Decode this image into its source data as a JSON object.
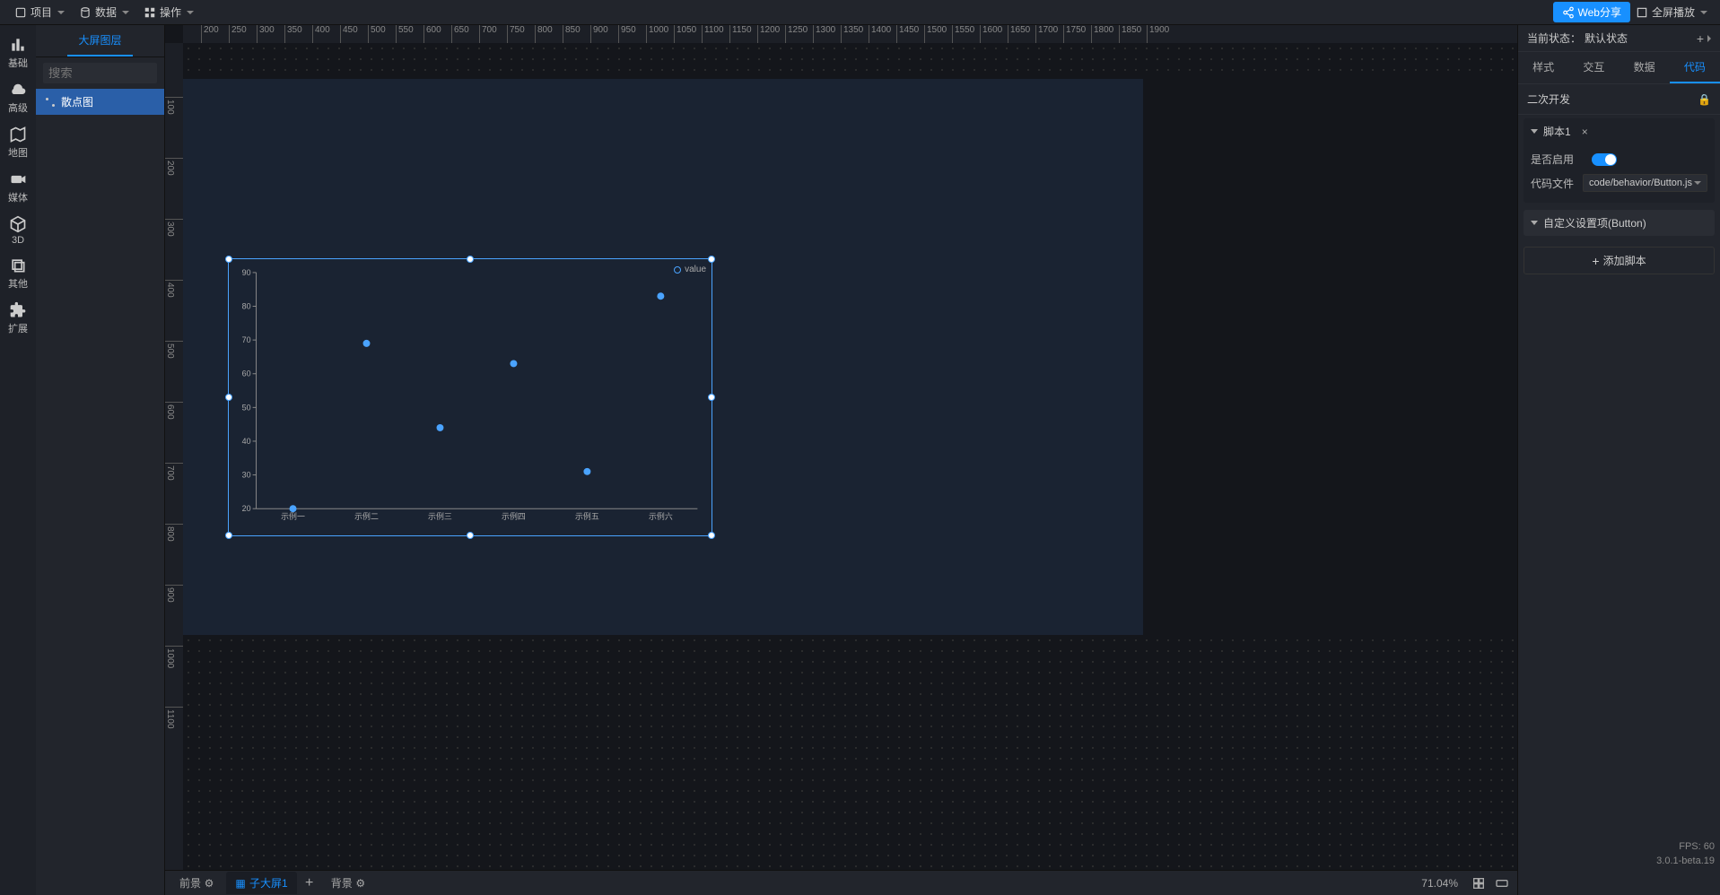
{
  "topbar": {
    "project": "项目",
    "data": "数据",
    "operation": "操作",
    "share": "Web分享",
    "fullscreen": "全屏播放"
  },
  "left_tools": [
    {
      "label": "基础"
    },
    {
      "label": "高级"
    },
    {
      "label": "地图"
    },
    {
      "label": "媒体"
    },
    {
      "label": "3D"
    },
    {
      "label": "其他"
    },
    {
      "label": "扩展"
    }
  ],
  "layer_panel": {
    "tab": "大屏图层",
    "search_placeholder": "搜索",
    "items": [
      {
        "name": "散点图",
        "selected": true
      }
    ]
  },
  "chart_data": {
    "type": "scatter",
    "legend": "value",
    "categories": [
      "示例一",
      "示例二",
      "示例三",
      "示例四",
      "示例五",
      "示例六"
    ],
    "values": [
      20,
      69,
      44,
      63,
      31,
      83
    ],
    "y_ticks": [
      20,
      30,
      40,
      50,
      60,
      70,
      80,
      90
    ],
    "ylim": [
      20,
      90
    ]
  },
  "bottom": {
    "foreground": "前景",
    "sub_screen": "子大屏1",
    "background": "背景",
    "zoom": "71.04%"
  },
  "right": {
    "state_label": "当前状态：",
    "state_value": "默认状态",
    "tabs": [
      "样式",
      "交互",
      "数据",
      "代码"
    ],
    "active_tab": 3,
    "section": "二次开发",
    "script": {
      "title": "脚本1",
      "enable_label": "是否启用",
      "enabled": true,
      "file_label": "代码文件",
      "file_value": "code/behavior/Button.js",
      "custom_settings": "自定义设置项(Button)",
      "add_script": "添加脚本"
    }
  },
  "footer": {
    "fps": "FPS: 60",
    "version": "3.0.1-beta.19"
  },
  "ruler_h": [
    200,
    250,
    300,
    350,
    400,
    450,
    500,
    550,
    600,
    650,
    700,
    750,
    800,
    850,
    900,
    950,
    1000,
    1050,
    1100,
    1150,
    1200,
    1250,
    1300,
    1350,
    1400,
    1450,
    1500,
    1550,
    1600,
    1650,
    1700,
    1750,
    1800,
    1850,
    1900
  ],
  "ruler_v": [
    100,
    200,
    300,
    400,
    500,
    600,
    700,
    800,
    900,
    1000,
    1100
  ]
}
